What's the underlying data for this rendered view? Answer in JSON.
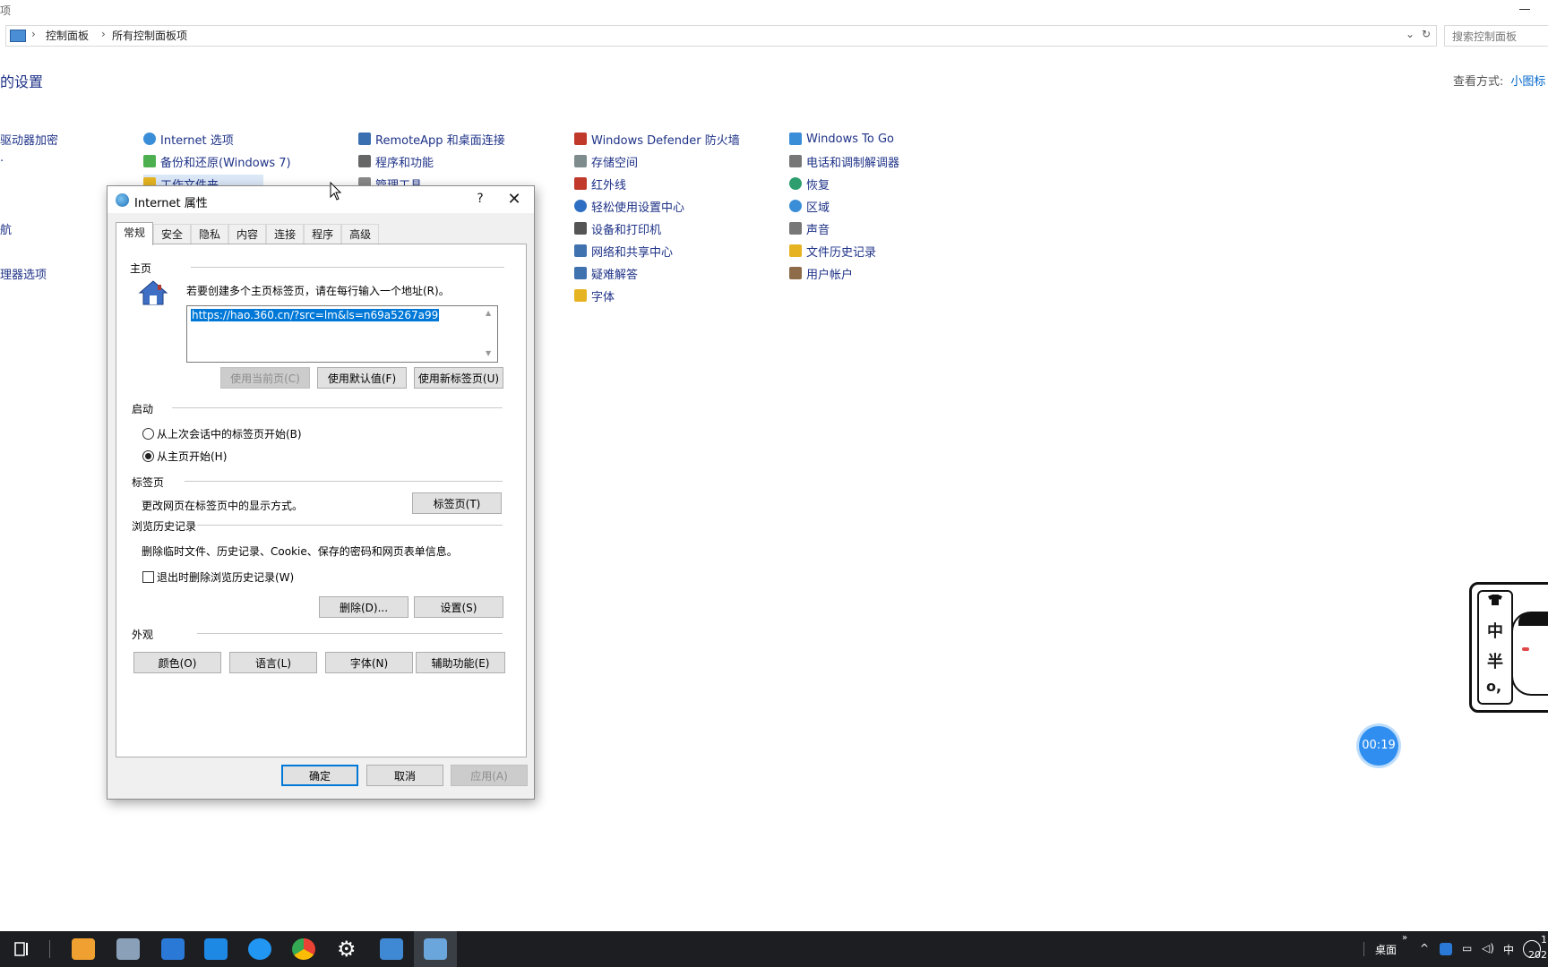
{
  "window": {
    "title_fragment": "项",
    "breadcrumb": [
      "控制面板",
      "所有控制面板项"
    ],
    "search_placeholder": "搜索控制面板",
    "heading": "的设置",
    "view_by_label": "查看方式:",
    "view_by_value": "小图标"
  },
  "control_panel": {
    "col0": [
      {
        "label": "驱动器加密",
        "icon": "bitlocker-icon"
      },
      {
        "label": "",
        "icon": ""
      },
      {
        "label": "",
        "icon": ""
      },
      {
        "label": "航",
        "icon": ""
      },
      {
        "label": "",
        "icon": ""
      },
      {
        "label": "理器选项",
        "icon": ""
      }
    ],
    "col1": [
      {
        "label": "Internet 选项",
        "icon": "internet-options-icon",
        "color": "#3a8ed8"
      },
      {
        "label": "备份和还原(Windows 7)",
        "icon": "backup-restore-icon",
        "color": "#4caf50"
      },
      {
        "label": "工作文件夹",
        "icon": "work-folders-icon",
        "color": "#e6b422"
      }
    ],
    "col2": [
      {
        "label": "RemoteApp 和桌面连接",
        "icon": "remoteapp-icon",
        "color": "#3a6fb0"
      },
      {
        "label": "程序和功能",
        "icon": "programs-features-icon",
        "color": "#666666"
      },
      {
        "label": "管理工具",
        "icon": "admin-tools-icon",
        "color": "#888888"
      }
    ],
    "col3": [
      {
        "label": "Windows Defender 防火墙",
        "icon": "firewall-icon",
        "color": "#c0392b"
      },
      {
        "label": "存储空间",
        "icon": "storage-spaces-icon",
        "color": "#7f8c8d"
      },
      {
        "label": "红外线",
        "icon": "infrared-icon",
        "color": "#c0392b"
      },
      {
        "label": "轻松使用设置中心",
        "icon": "ease-of-access-icon",
        "color": "#2e6fc4"
      },
      {
        "label": "设备和打印机",
        "icon": "devices-printers-icon",
        "color": "#555555"
      },
      {
        "label": "网络和共享中心",
        "icon": "network-sharing-icon",
        "color": "#3f72af"
      },
      {
        "label": "疑难解答",
        "icon": "troubleshooting-icon",
        "color": "#3f72af"
      },
      {
        "label": "字体",
        "icon": "fonts-icon",
        "color": "#e6b422"
      }
    ],
    "col4": [
      {
        "label": "Windows To Go",
        "icon": "windows-to-go-icon",
        "color": "#3a8ed8"
      },
      {
        "label": "电话和调制解调器",
        "icon": "phone-modem-icon",
        "color": "#777777"
      },
      {
        "label": "恢复",
        "icon": "recovery-icon",
        "color": "#2e9e6e"
      },
      {
        "label": "区域",
        "icon": "region-icon",
        "color": "#3a8ed8"
      },
      {
        "label": "声音",
        "icon": "sound-icon",
        "color": "#777777"
      },
      {
        "label": "文件历史记录",
        "icon": "file-history-icon",
        "color": "#e6b422"
      },
      {
        "label": "用户帐户",
        "icon": "user-accounts-icon",
        "color": "#8e6c4a"
      }
    ]
  },
  "dialog": {
    "title": "Internet 属性",
    "help": "?",
    "close": "✕",
    "tabs": [
      "常规",
      "安全",
      "隐私",
      "内容",
      "连接",
      "程序",
      "高级"
    ],
    "home": {
      "group": "主页",
      "desc": "若要创建多个主页标签页，请在每行输入一个地址(R)。",
      "url": "https://hao.360.cn/?src=lm&ls=n69a5267a99",
      "btn_current": "使用当前页(C)",
      "btn_default": "使用默认值(F)",
      "btn_newtab": "使用新标签页(U)"
    },
    "startup": {
      "group": "启动",
      "opt_last": "从上次会话中的标签页开始(B)",
      "opt_home": "从主页开始(H)"
    },
    "tabs_section": {
      "group": "标签页",
      "desc": "更改网页在标签页中的显示方式。",
      "btn": "标签页(T)"
    },
    "history": {
      "group": "浏览历史记录",
      "desc": "删除临时文件、历史记录、Cookie、保存的密码和网页表单信息。",
      "checkbox": "退出时删除浏览历史记录(W)",
      "btn_delete": "删除(D)...",
      "btn_settings": "设置(S)"
    },
    "appearance": {
      "group": "外观",
      "btn_colors": "颜色(O)",
      "btn_languages": "语言(L)",
      "btn_fonts": "字体(N)",
      "btn_accessibility": "辅助功能(E)"
    },
    "ok": "确定",
    "cancel": "取消",
    "apply": "应用(A)"
  },
  "overlay": {
    "timer": "00:19",
    "sticker_chars": [
      "中",
      "半",
      "o,"
    ]
  },
  "taskbar": {
    "desktop_label": "桌面",
    "ime": "中",
    "time_fragment": "1",
    "date_fragment": "202"
  }
}
